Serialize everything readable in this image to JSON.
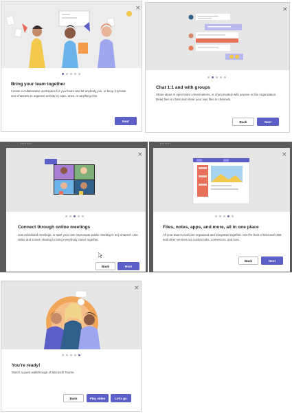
{
  "close_glyph": "×",
  "slides": [
    {
      "title": "Bring your team together",
      "description": "Create a collaborative workspace for your team and let anybody join, or keep it private. Use channels to organize activity by topic, area, or anything else.",
      "active_dot": 1,
      "buttons": {
        "next": "Next"
      }
    },
    {
      "title": "Chat 1:1 and with groups",
      "description": "Share ideas in open team conversations, or chat privately with anyone in this organization. Read files in chats and share your own files in channels.",
      "active_dot": 2,
      "buttons": {
        "back": "Back",
        "next": "Next"
      }
    },
    {
      "title": "Connect through online meetings",
      "description": "Join scheduled meetings, or start your own impromptu public meeting in any channel. Use video and screen sharing to bring everybody closer together.",
      "active_dot": 3,
      "buttons": {
        "back": "Back",
        "next": "Next"
      }
    },
    {
      "title": "Files, notes, apps, and more, all in one place",
      "description": "All your team's tools are organized and integrated together. Get the best of Microsoft 365 and other services via custom tabs, connectors, and bots.",
      "active_dot": 4,
      "buttons": {
        "back": "Back",
        "next": "Next"
      }
    },
    {
      "title": "You're ready!",
      "description": "Watch a quick walkthrough of Microsoft Teams.",
      "active_dot": 5,
      "buttons": {
        "back": "Back",
        "play": "Play video",
        "go": "Let's go"
      }
    }
  ],
  "dot_count": 5,
  "colors": {
    "accent": "#5b5fc7",
    "illustration_bg": "#e6e6e6",
    "dot_active": "#6264a7",
    "dot_inactive": "#c8c6c4"
  }
}
